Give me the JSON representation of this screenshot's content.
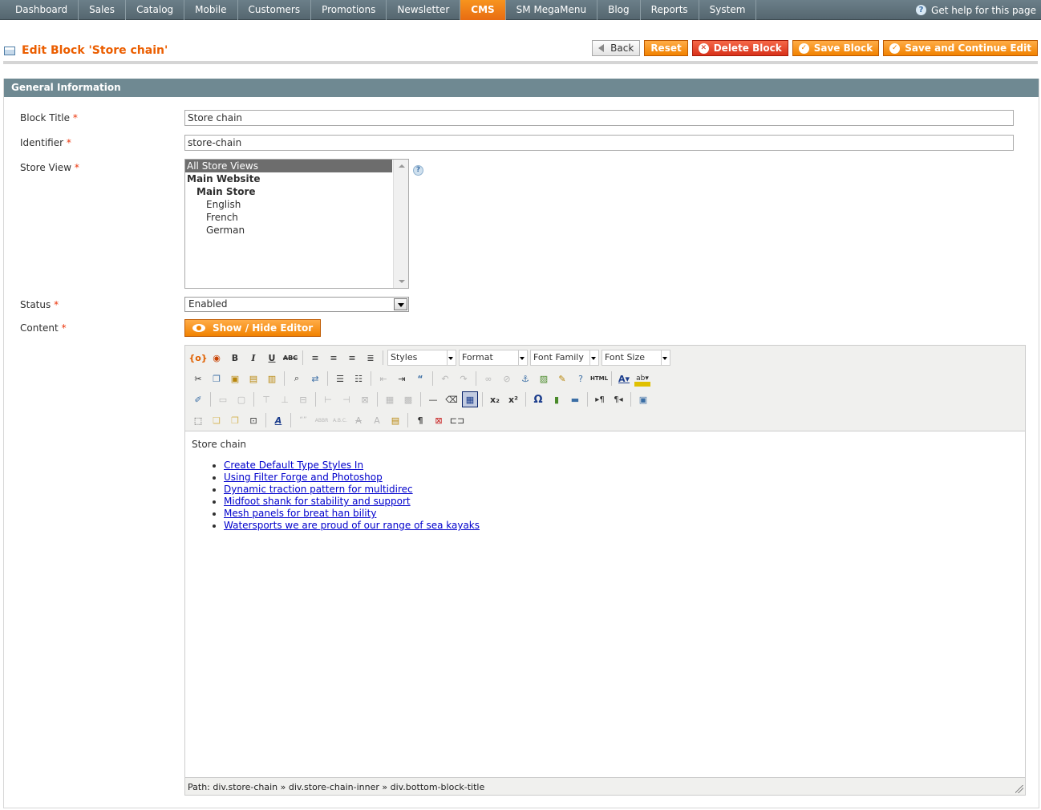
{
  "nav": {
    "items": [
      "Dashboard",
      "Sales",
      "Catalog",
      "Mobile",
      "Customers",
      "Promotions",
      "Newsletter",
      "CMS",
      "SM MegaMenu",
      "Blog",
      "Reports",
      "System"
    ],
    "active": "CMS",
    "help": "Get help for this page"
  },
  "header": {
    "title": "Edit Block 'Store chain'",
    "buttons": {
      "back": "Back",
      "reset": "Reset",
      "delete": "Delete Block",
      "save": "Save Block",
      "save_continue": "Save and Continue Edit"
    }
  },
  "section": {
    "title": "General Information"
  },
  "form": {
    "block_title": {
      "label": "Block Title",
      "value": "Store chain"
    },
    "identifier": {
      "label": "Identifier",
      "value": "store-chain"
    },
    "store_view": {
      "label": "Store View",
      "options": [
        {
          "text": "All Store Views",
          "selected": true
        },
        {
          "text": "Main Website"
        },
        {
          "text": "Main Store"
        },
        {
          "text": "English"
        },
        {
          "text": "French"
        },
        {
          "text": "German"
        }
      ]
    },
    "status": {
      "label": "Status",
      "value": "Enabled"
    },
    "content": {
      "label": "Content",
      "toggle": "Show / Hide Editor"
    },
    "required_mark": "*"
  },
  "editor": {
    "selects": {
      "styles": "Styles",
      "format": "Format",
      "font_family": "Font Family",
      "font_size": "Font Size"
    },
    "heading": "Store chain",
    "links": [
      "Create Default Type Styles In",
      "Using Filter Forge and Photoshop",
      "Dynamic traction pattern for multidirec",
      "Midfoot shank for stability and support",
      "Mesh panels for breat han bility",
      "Watersports we are proud of our range of sea kayaks"
    ],
    "path": "Path: div.store-chain » div.store-chain-inner » div.bottom-block-title"
  },
  "icons": {
    "help": "question-icon",
    "delete": "delete-icon",
    "save": "check-icon"
  }
}
